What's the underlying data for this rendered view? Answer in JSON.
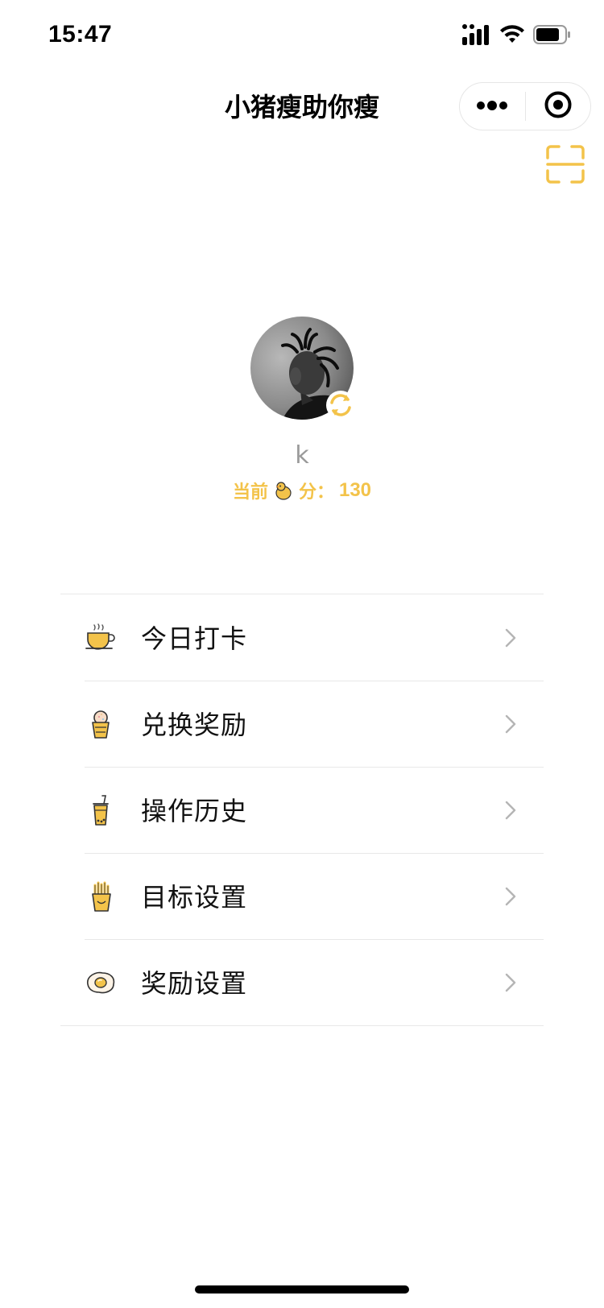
{
  "status_bar": {
    "time": "15:47"
  },
  "nav": {
    "title": "小猪瘦助你瘦"
  },
  "colors": {
    "accent": "#f3c34a",
    "text": "#111111",
    "muted": "#9a9a9a",
    "divider": "#e8e8e8"
  },
  "profile": {
    "username": "k",
    "score_prefix": "当前",
    "score_suffix": "分：",
    "score_value": "130"
  },
  "menu": [
    {
      "label": "今日打卡",
      "icon": "coffee-cup-icon"
    },
    {
      "label": "兑换奖励",
      "icon": "ice-cream-icon"
    },
    {
      "label": "操作历史",
      "icon": "bubble-tea-icon"
    },
    {
      "label": "目标设置",
      "icon": "french-fries-icon"
    },
    {
      "label": "奖励设置",
      "icon": "fried-egg-icon"
    }
  ]
}
